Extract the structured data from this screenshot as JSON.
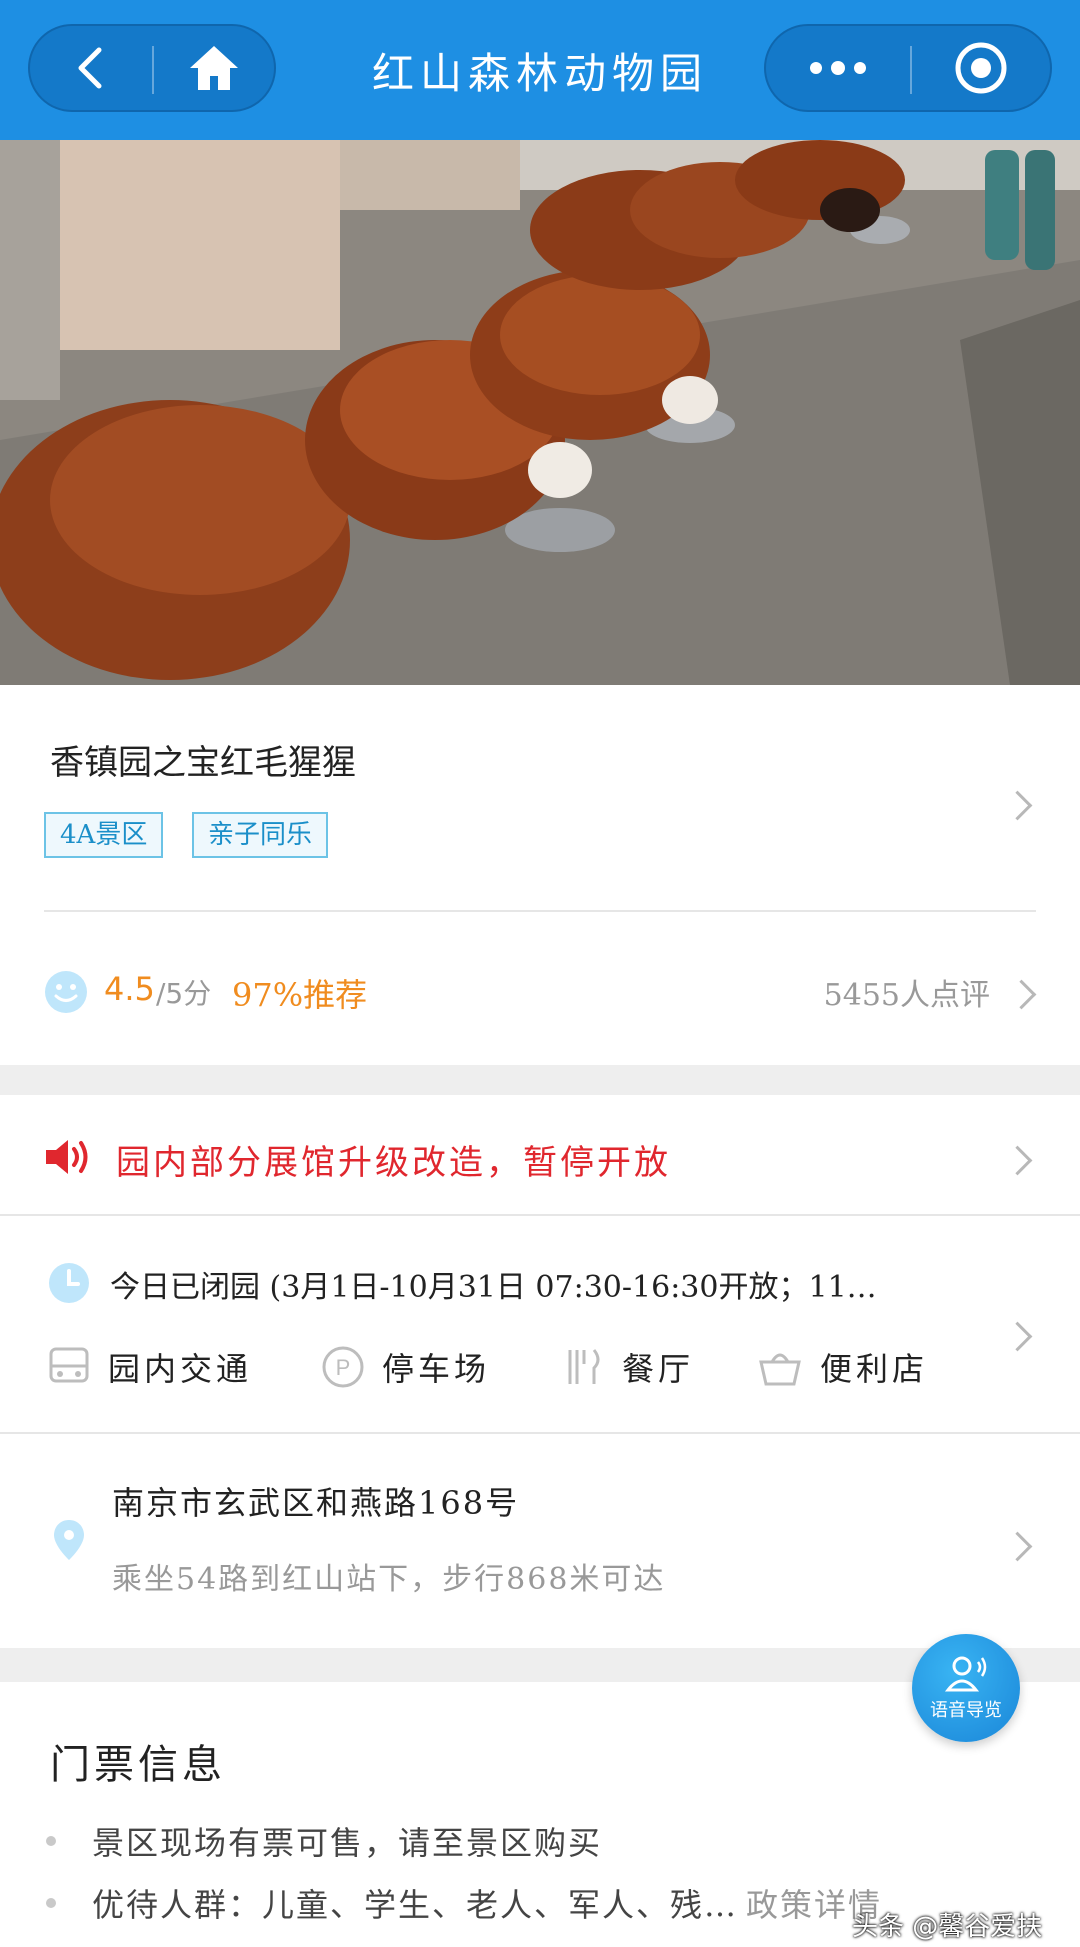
{
  "header": {
    "title": "红山森林动物园",
    "icons": {
      "back": "back-arrow-icon",
      "home": "home-icon",
      "more": "more-dots-icon",
      "close": "target-close-icon"
    }
  },
  "hero": {
    "description_icon": "red-panda-photo"
  },
  "attraction": {
    "subtitle": "香镇园之宝红毛猩猩",
    "tags": [
      "4A景区",
      "亲子同乐"
    ]
  },
  "rating": {
    "score": "4.5",
    "score_suffix": "/5分",
    "recommend": "97%推荐",
    "reviews": "5455人点评"
  },
  "notice": {
    "text": "园内部分展馆升级改造，暂停开放"
  },
  "hours": {
    "text": "今日已闭园 (3月1日-10月31日 07:30-16:30开放；11…"
  },
  "facilities": [
    {
      "label": "园内交通",
      "icon": "bus-icon"
    },
    {
      "label": "停车场",
      "icon": "parking-icon"
    },
    {
      "label": "餐厅",
      "icon": "restaurant-icon"
    },
    {
      "label": "便利店",
      "icon": "shop-basket-icon"
    }
  ],
  "address": {
    "line1": "南京市玄武区和燕路168号",
    "line2": "乘坐54路到红山站下，步行868米可达"
  },
  "tickets": {
    "title": "门票信息",
    "items": [
      "景区现场有票可售，请至景区购买",
      "优待人群：儿童、学生、老人、军人、残…"
    ],
    "policy_link": "政策详情"
  },
  "voice_guide": {
    "label": "语音导览"
  },
  "watermark": "头条 @馨谷爱扶",
  "colors": {
    "header": "#1e8fe3",
    "accent_orange": "#f08c1f",
    "notice_red": "#e0272e",
    "tag_blue": "#1b8fc9"
  }
}
